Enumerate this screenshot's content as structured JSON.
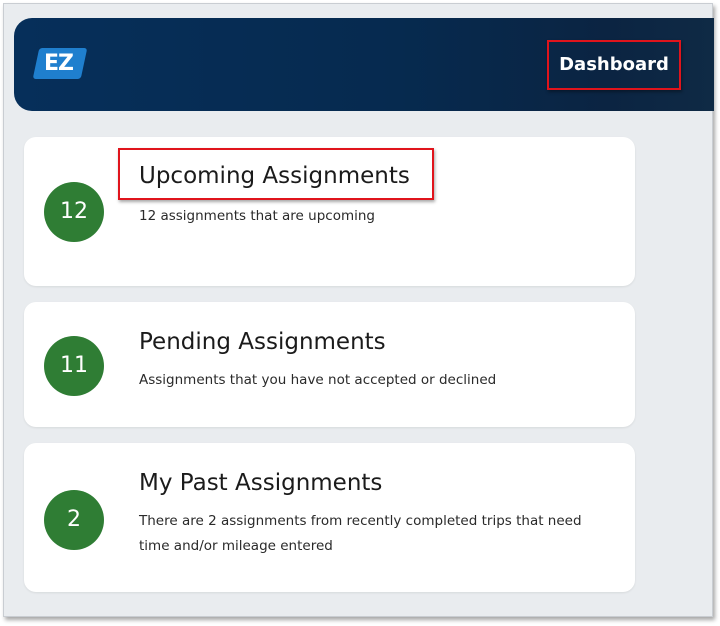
{
  "header": {
    "logo_text": "EZ",
    "nav_label": "Dashboard"
  },
  "cards": [
    {
      "count": "12",
      "title": "Upcoming Assignments",
      "description": "12 assignments that are upcoming"
    },
    {
      "count": "11",
      "title": "Pending Assignments",
      "description": "Assignments that you have not accepted or declined"
    },
    {
      "count": "2",
      "title": "My Past Assignments",
      "description": "There are 2 assignments from recently completed trips that need time and/or mileage entered"
    }
  ],
  "colors": {
    "header_bg": "#062f5a",
    "logo_bg": "#1f7fce",
    "badge_green": "#2f7d34",
    "highlight_red": "#e0141c",
    "page_bg": "#e9ecef"
  }
}
